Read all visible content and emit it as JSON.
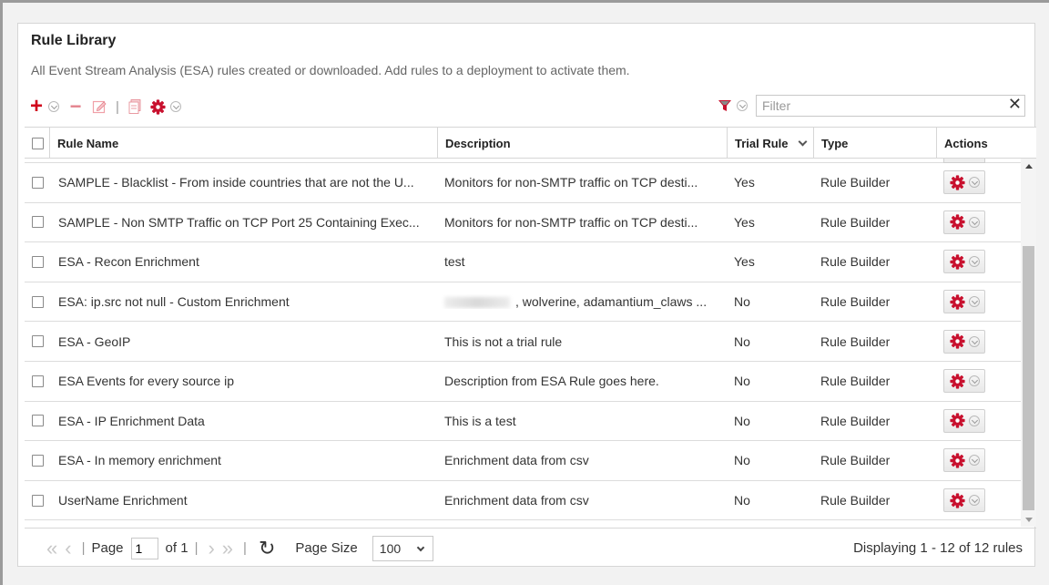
{
  "panel": {
    "title": "Rule Library",
    "subtitle": "All Event Stream Analysis (ESA) rules created or downloaded. Add rules to a deployment to activate them."
  },
  "toolbar": {
    "add_icon": "plus-icon",
    "remove_icon": "minus-icon",
    "edit_icon": "edit-icon",
    "clone_icon": "document-icon",
    "settings_icon": "gear-icon",
    "accent_color": "#d0021b"
  },
  "filter": {
    "placeholder": "Filter",
    "value": ""
  },
  "table": {
    "columns": [
      "Rule Name",
      "Description",
      "Trial Rule",
      "Type",
      "Actions"
    ],
    "sorted_column": "Trial Rule",
    "rows": [
      {
        "name": "SAMPLE - Blacklist - From inside countries that are not the U...",
        "description": "Monitors for non-SMTP traffic on TCP desti...",
        "trial": "Yes",
        "type": "Rule Builder"
      },
      {
        "name": "SAMPLE - Non SMTP Traffic on TCP Port 25 Containing Exec...",
        "description": "Monitors for non-SMTP traffic on TCP desti...",
        "trial": "Yes",
        "type": "Rule Builder"
      },
      {
        "name": "ESA - Recon Enrichment",
        "description": "test",
        "trial": "Yes",
        "type": "Rule Builder"
      },
      {
        "name": "ESA: ip.src not null - Custom Enrichment",
        "description": ", wolverine, adamantium_claws ...",
        "trial": "No",
        "type": "Rule Builder"
      },
      {
        "name": "ESA - GeoIP",
        "description": "This is not a trial rule",
        "trial": "No",
        "type": "Rule Builder"
      },
      {
        "name": "ESA Events for every source ip",
        "description": "Description from ESA Rule goes here.",
        "trial": "No",
        "type": "Rule Builder"
      },
      {
        "name": "ESA - IP Enrichment Data",
        "description": "This is a test",
        "trial": "No",
        "type": "Rule Builder"
      },
      {
        "name": "ESA - In memory enrichment",
        "description": "Enrichment data from csv",
        "trial": "No",
        "type": "Rule Builder"
      },
      {
        "name": "UserName Enrichment",
        "description": "Enrichment data from csv",
        "trial": "No",
        "type": "Rule Builder"
      }
    ]
  },
  "pager": {
    "page_label": "Page",
    "page_value": "1",
    "of_label": "of 1",
    "page_size_label": "Page Size",
    "page_size_value": "100",
    "display_info": "Displaying 1 - 12 of 12 rules"
  }
}
